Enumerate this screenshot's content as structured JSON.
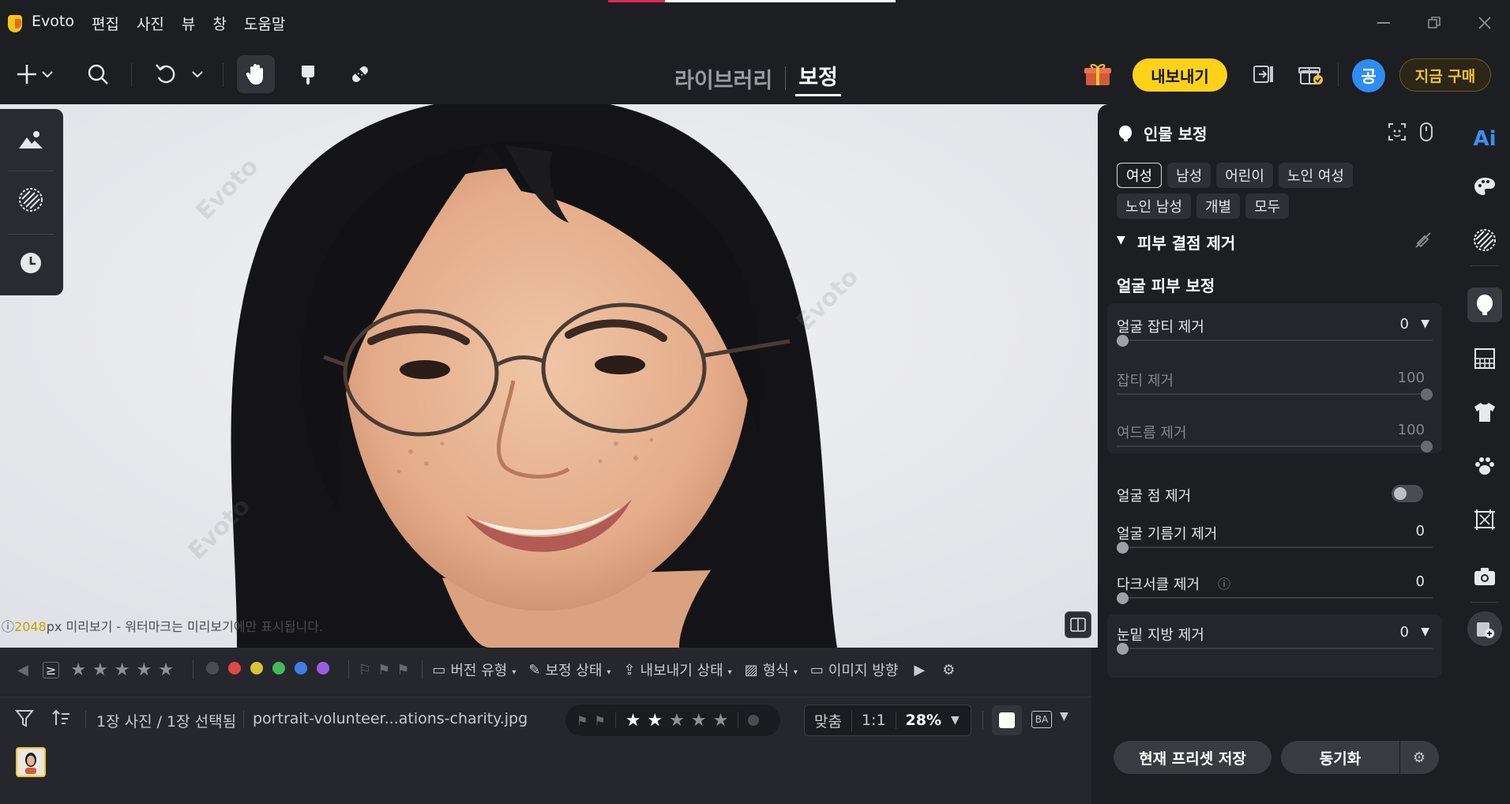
{
  "app": {
    "name": "Evoto"
  },
  "menu": [
    "편집",
    "사진",
    "뷰",
    "창",
    "도움말"
  ],
  "toolbar": {
    "tabs": [
      {
        "label": "라이브러리"
      },
      {
        "label": "보정"
      }
    ],
    "export_label": "내보내기",
    "buy_label": "지금 구매",
    "avatar_letter": "공"
  },
  "canvas": {
    "watermark": "Evoto",
    "preview_size": "2048",
    "preview_unit": "px",
    "preview_note": " 미리보기 - 워터마크는 미리보기에만 표시됩니다."
  },
  "filmstrip": {
    "rating_op": "≥",
    "filter_version": "버전 유형",
    "filter_edit": "보정 상태",
    "filter_export": "내보내기 상태",
    "filter_format": "형식",
    "filter_orientation": "이미지 방향",
    "selection_count": "1장 사진 / 1장 선택됨",
    "filename": "portrait-volunteer...ations-charity.jpg",
    "fit_label": "맞춤",
    "ratio_label": "1:1",
    "zoom": "28%",
    "photo_rating": 2,
    "label_colors": [
      "#4b4c52",
      "#e04848",
      "#d8c43a",
      "#45b85b",
      "#3f7ee8",
      "#9a5fe0"
    ]
  },
  "panel": {
    "title": "인물 보정",
    "presets": [
      "여성",
      "남성",
      "어린이",
      "노인 여성",
      "노인 남성",
      "개별",
      "모두"
    ],
    "selected_preset": "여성",
    "section": "피부 결점 제거",
    "subsection": "얼굴 피부 보정",
    "sliders": {
      "blemish": {
        "label": "얼굴 잡티 제거",
        "value": "0"
      },
      "spot": {
        "label": "잡티 제거",
        "value": "100"
      },
      "acne": {
        "label": "여드름 제거",
        "value": "100"
      },
      "mole": {
        "label": "얼굴 점 제거"
      },
      "oil": {
        "label": "얼굴 기름기 제거",
        "value": "0"
      },
      "dark_circle": {
        "label": "다크서클 제거",
        "value": "0"
      },
      "eye_fat": {
        "label": "눈밑 지방 제거",
        "value": "0"
      }
    },
    "save_preset": "현재 프리셋 저장",
    "sync": "동기화"
  },
  "rail": {
    "ai_label": "Ai"
  }
}
